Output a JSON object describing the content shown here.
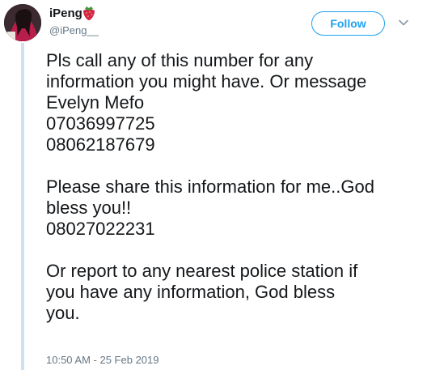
{
  "author": {
    "display_name": "iPeng",
    "handle": "@iPeng__",
    "emoji_icon": "strawberry-emoji"
  },
  "actions": {
    "follow_label": "Follow",
    "more_icon": "chevron-down-icon"
  },
  "tweet": {
    "paragraph1_lines": [
      "Pls call any of this number for any",
      "information you might have. Or message",
      "Evelyn Mefo",
      "07036997725",
      "08062187679"
    ],
    "paragraph2_lines": [
      "Please share this information for me..God",
      "bless you!!",
      "08027022231"
    ],
    "paragraph3_lines": [
      "Or report to any nearest police station if",
      "you have any information, God bless",
      "you."
    ],
    "timestamp": "10:50 AM - 25 Feb 2019"
  },
  "colors": {
    "accent": "#1da1f2",
    "text": "#14171a",
    "muted": "#657786",
    "thread_line": "#cfe1ee"
  }
}
